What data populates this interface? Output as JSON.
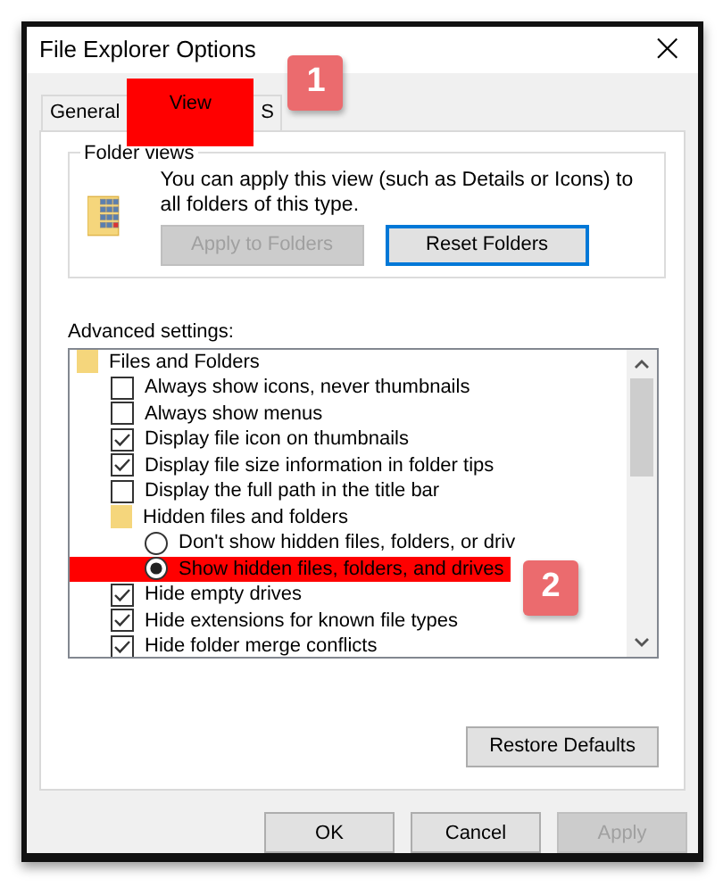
{
  "window": {
    "title": "File Explorer Options",
    "close": "×"
  },
  "tabs": [
    {
      "label": "General",
      "selected": false,
      "highlighted": false
    },
    {
      "label": "View",
      "selected": true,
      "highlighted": true
    },
    {
      "label": "S",
      "selected": false,
      "highlighted": false
    }
  ],
  "folder_views": {
    "title": "Folder views",
    "text": "You can apply this view (such as Details or Icons) to all folders of this type.",
    "buttons": [
      {
        "label": "Apply to Folders",
        "disabled": true,
        "focused": false
      },
      {
        "label": "Reset Folders",
        "disabled": false,
        "focused": true
      }
    ]
  },
  "advanced": {
    "label": "Advanced settings:",
    "tree": [
      {
        "kind": "folder",
        "label": "Files and Folders",
        "children": [
          {
            "kind": "checkbox",
            "label": "Always show icons, never thumbnails",
            "checked": false
          },
          {
            "kind": "checkbox",
            "label": "Always show menus",
            "checked": false
          },
          {
            "kind": "checkbox",
            "label": "Display file icon on thumbnails",
            "checked": true
          },
          {
            "kind": "checkbox",
            "label": "Display file size information in folder tips",
            "checked": true
          },
          {
            "kind": "checkbox",
            "label": "Display the full path in the title bar",
            "checked": false
          },
          {
            "kind": "folder",
            "label": "Hidden files and folders",
            "children": [
              {
                "kind": "radio",
                "label": "Don't show hidden files, folders, or driv",
                "selected": false,
                "highlighted": false
              },
              {
                "kind": "radio",
                "label": "Show hidden files, folders, and drives",
                "selected": true,
                "highlighted": true
              }
            ]
          },
          {
            "kind": "checkbox",
            "label": "Hide empty drives",
            "checked": true
          },
          {
            "kind": "checkbox",
            "label": "Hide extensions for known file types",
            "checked": true
          },
          {
            "kind": "checkbox",
            "label": "Hide folder merge conflicts",
            "checked": true
          }
        ]
      }
    ],
    "restore_button": "Restore Defaults"
  },
  "buttons": [
    {
      "label": "OK",
      "disabled": false
    },
    {
      "label": "Cancel",
      "disabled": false
    },
    {
      "label": "Apply",
      "disabled": true
    }
  ],
  "annotations": [
    {
      "label": "1"
    },
    {
      "label": "2"
    }
  ]
}
